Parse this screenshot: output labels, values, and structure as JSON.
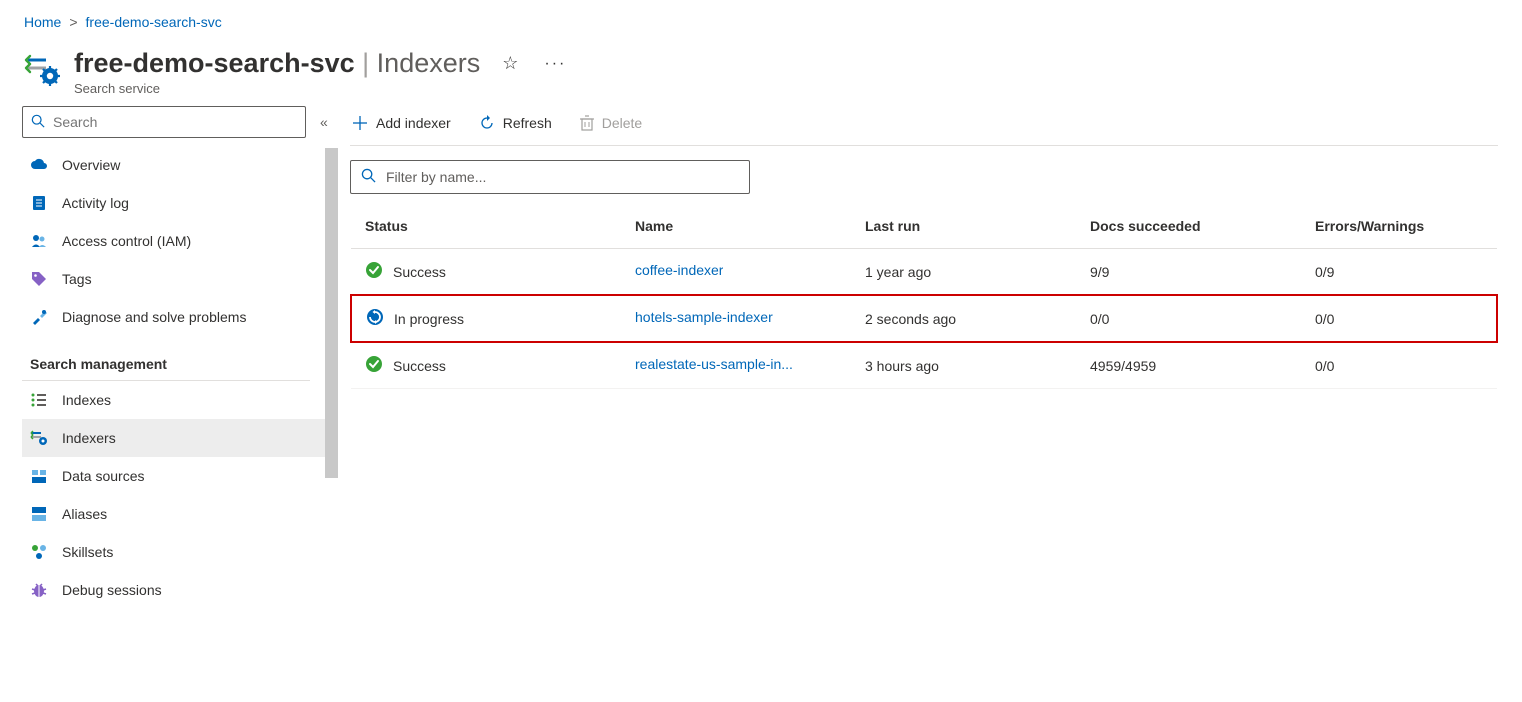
{
  "breadcrumb": {
    "home": "Home",
    "resource": "free-demo-search-svc"
  },
  "header": {
    "resource": "free-demo-search-svc",
    "section": "Indexers",
    "subtitle": "Search service"
  },
  "sidebar": {
    "search_placeholder": "Search",
    "items": [
      {
        "label": "Overview",
        "icon": "cloud",
        "selected": false
      },
      {
        "label": "Activity log",
        "icon": "log",
        "selected": false
      },
      {
        "label": "Access control (IAM)",
        "icon": "people",
        "selected": false
      },
      {
        "label": "Tags",
        "icon": "tag",
        "selected": false
      },
      {
        "label": "Diagnose and solve problems",
        "icon": "tools",
        "selected": false
      }
    ],
    "group_header": "Search management",
    "group_items": [
      {
        "label": "Indexes",
        "icon": "list",
        "selected": false
      },
      {
        "label": "Indexers",
        "icon": "indexer",
        "selected": true
      },
      {
        "label": "Data sources",
        "icon": "datasource",
        "selected": false
      },
      {
        "label": "Aliases",
        "icon": "alias",
        "selected": false
      },
      {
        "label": "Skillsets",
        "icon": "skillset",
        "selected": false
      },
      {
        "label": "Debug sessions",
        "icon": "debug",
        "selected": false
      }
    ]
  },
  "toolbar": {
    "add": "Add indexer",
    "refresh": "Refresh",
    "delete": "Delete"
  },
  "filter": {
    "placeholder": "Filter by name..."
  },
  "table": {
    "headers": {
      "status": "Status",
      "name": "Name",
      "last_run": "Last run",
      "docs": "Docs succeeded",
      "errors": "Errors/Warnings"
    },
    "rows": [
      {
        "status": "Success",
        "status_icon": "success",
        "name": "coffee-indexer",
        "last_run": "1 year ago",
        "docs": "9/9",
        "errors": "0/9",
        "highlight": false
      },
      {
        "status": "In progress",
        "status_icon": "progress",
        "name": "hotels-sample-indexer",
        "last_run": "2 seconds ago",
        "docs": "0/0",
        "errors": "0/0",
        "highlight": true
      },
      {
        "status": "Success",
        "status_icon": "success",
        "name": "realestate-us-sample-in...",
        "last_run": "3 hours ago",
        "docs": "4959/4959",
        "errors": "0/0",
        "highlight": false
      }
    ]
  }
}
